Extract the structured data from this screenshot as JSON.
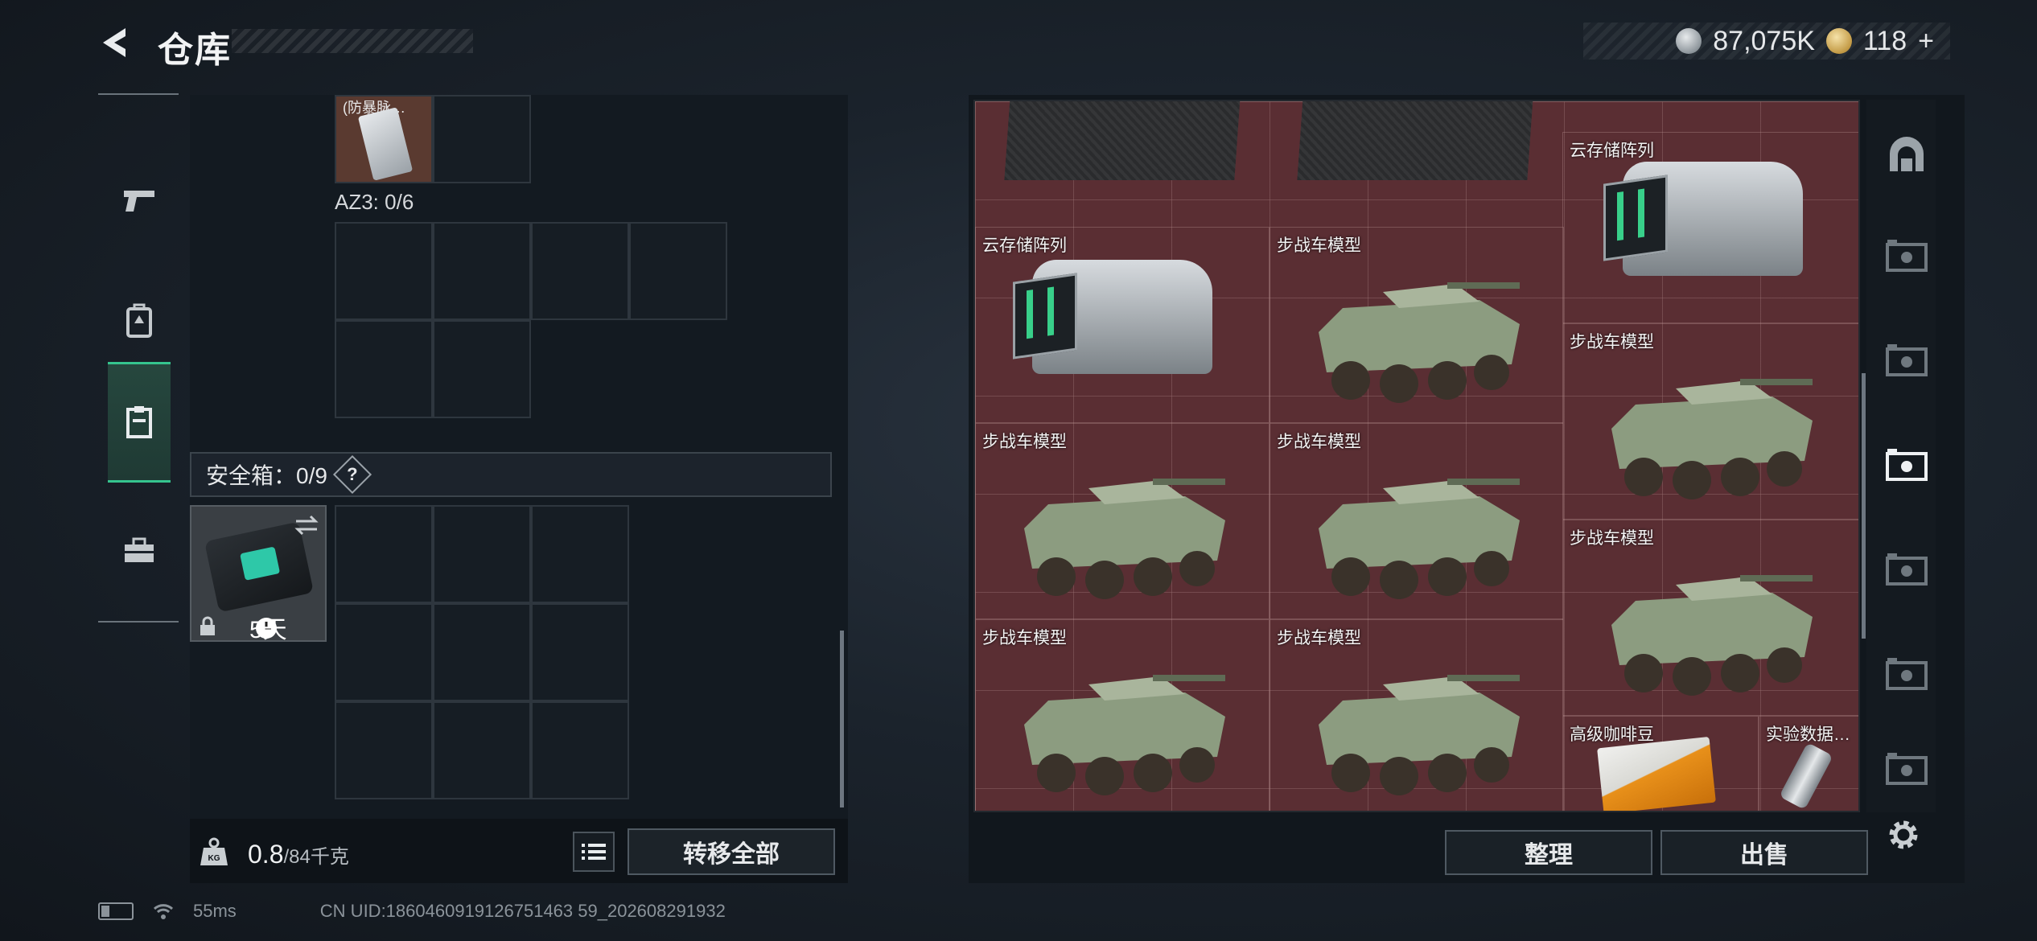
{
  "header": {
    "title": "仓库",
    "currencies": [
      {
        "icon": "silver-coin-icon",
        "value": "87,075K"
      },
      {
        "icon": "gold-coin-icon",
        "value": "118"
      }
    ],
    "add_symbol": "+"
  },
  "left_nav": [
    {
      "icon": "pistol-icon",
      "active": false
    },
    {
      "icon": "backpack-icon",
      "active": false
    },
    {
      "icon": "vest-icon",
      "active": true
    },
    {
      "icon": "toolbox-icon",
      "active": false
    }
  ],
  "inventory": {
    "partial_item_label": "(防暴脉…",
    "az3_label": "AZ3: 0/6",
    "safebox_label": "安全箱：0/9",
    "safebox_help": "?",
    "safebox_days": "5天",
    "weight_value": "0.8",
    "weight_max": "/84千克",
    "transfer_all": "转移全部"
  },
  "stash_items": [
    {
      "label": "云存储阵列",
      "kind": "server"
    },
    {
      "label": "云存储阵列",
      "kind": "server"
    },
    {
      "label": "步战车模型",
      "kind": "vehicle"
    },
    {
      "label": "步战车模型",
      "kind": "vehicle"
    },
    {
      "label": "步战车模型",
      "kind": "vehicle"
    },
    {
      "label": "步战车模型",
      "kind": "vehicle"
    },
    {
      "label": "步战车模型",
      "kind": "vehicle"
    },
    {
      "label": "步战车模型",
      "kind": "vehicle"
    },
    {
      "label": "步战车模型",
      "kind": "vehicle"
    },
    {
      "label": "高级咖啡豆",
      "kind": "coffee"
    },
    {
      "label": "实验数据…",
      "kind": "flask"
    }
  ],
  "right_tabs": [
    {
      "icon": "arch-icon",
      "active": false
    },
    {
      "icon": "case-icon",
      "active": false
    },
    {
      "icon": "case-icon",
      "active": false
    },
    {
      "icon": "case-icon",
      "active": true
    },
    {
      "icon": "case-icon",
      "active": false
    },
    {
      "icon": "case-icon",
      "active": false
    },
    {
      "icon": "case-icon",
      "active": false
    }
  ],
  "actions": {
    "sort": "整理",
    "sell": "出售"
  },
  "status": {
    "ping": "55ms",
    "uid": "CN UID:1860460919126751463 59_202608291932"
  },
  "colors": {
    "accent": "#35c48e",
    "stash_bg": "#5a2e33"
  }
}
